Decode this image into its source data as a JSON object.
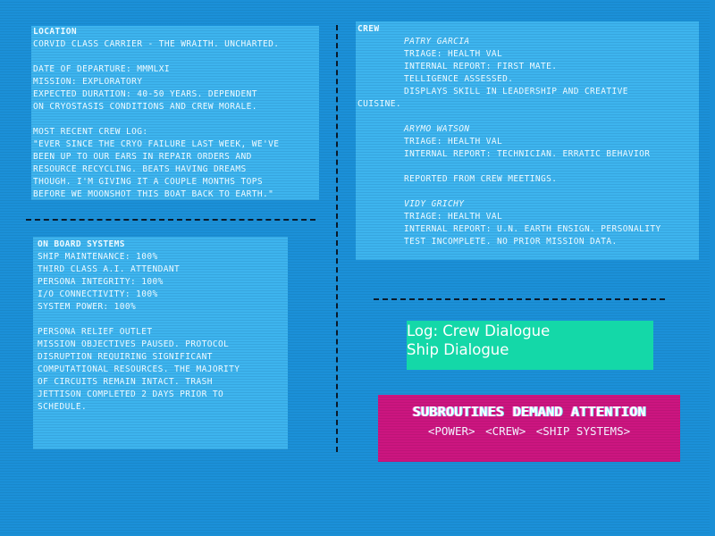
{
  "location": {
    "header": "LOCATION",
    "lines": [
      "CORVID CLASS CARRIER - THE WRAITH. UNCHARTED.",
      "",
      "DATE OF DEPARTURE: MMMLXI",
      "MISSION: EXPLORATORY",
      "EXPECTED DURATION: 40-50 YEARS. DEPENDENT",
      "ON CRYOSTASIS CONDITIONS AND CREW MORALE.",
      "",
      "MOST RECENT CREW LOG:",
      "\"EVER SINCE THE CRYO FAILURE LAST WEEK, WE'VE",
      "BEEN UP TO OUR EARS IN REPAIR ORDERS AND",
      "RESOURCE RECYCLING. BEATS HAVING DREAMS",
      "THOUGH. I'M GIVING IT A COUPLE MONTHS TOPS",
      "BEFORE WE MOONSHOT THIS BOAT BACK TO EARTH.\""
    ]
  },
  "systems": {
    "header": "ON BOARD SYSTEMS",
    "lines": [
      "SHIP MAINTENANCE: 100%",
      "THIRD CLASS A.I. ATTENDANT",
      "PERSONA INTEGRITY: 100%",
      "I/O CONNECTIVITY: 100%",
      "SYSTEM POWER: 100%",
      "",
      "PERSONA RELIEF OUTLET",
      "MISSION OBJECTIVES PAUSED. PROTOCOL",
      "DISRUPTION REQUIRING SIGNIFICANT",
      "COMPUTATIONAL RESOURCES. THE MAJORITY",
      "OF CIRCUITS REMAIN INTACT. TRASH",
      "JETTISON COMPLETED 2 DAYS PRIOR TO",
      "SCHEDULE."
    ]
  },
  "crew": {
    "header": "CREW",
    "members": [
      {
        "name": "PATRY GARCIA",
        "lines": [
          "TRIAGE: HEALTH VAL",
          "INTERNAL REPORT: FIRST MATE.",
          "TELLIGENCE ASSESSED.",
          "DISPLAYS SKILL IN LEADERSHIP AND CREATIVE"
        ],
        "wrap": "CUISINE."
      },
      {
        "name": "ARYMO WATSON",
        "lines": [
          "TRIAGE: HEALTH VAL",
          "INTERNAL REPORT: TECHNICIAN. ERRATIC BEHAVIOR",
          "",
          "REPORTED FROM CREW MEETINGS."
        ],
        "wrap": ""
      },
      {
        "name": "VIDY GRICHY",
        "lines": [
          "TRIAGE: HEALTH VAL",
          "INTERNAL REPORT: U.N. EARTH ENSIGN. PERSONALITY",
          "TEST INCOMPLETE. NO PRIOR MISSION DATA."
        ],
        "wrap": ""
      }
    ]
  },
  "log": {
    "crew_dialogue": "Log: Crew Dialogue",
    "ship_dialogue": "Ship Dialogue"
  },
  "alert": {
    "title": "SUBROUTINES DEMAND ATTENTION",
    "links": [
      "<POWER>",
      "<CREW>",
      "<SHIP SYSTEMS>"
    ]
  },
  "colors": {
    "background": "#1b90d8",
    "panel": "#3db4ee",
    "log_box": "#14d8a8",
    "alert_box": "#cc1580"
  }
}
